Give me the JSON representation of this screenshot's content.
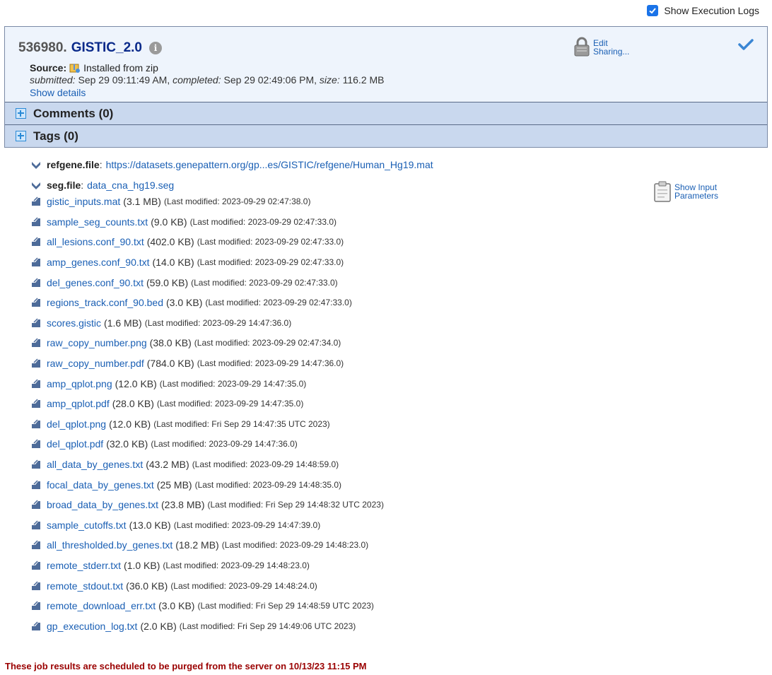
{
  "top": {
    "show_logs_label": "Show Execution Logs",
    "show_logs_checked": true
  },
  "job": {
    "id": "536980.",
    "task_name": "GISTIC_2.0",
    "source_label": "Source:",
    "source_value": "Installed from zip",
    "submitted_label": "submitted:",
    "submitted_value": " Sep 29 09:11:49 AM, ",
    "completed_label": "completed:",
    "completed_value": " Sep 29 02:49:06 PM, ",
    "size_label": "size:",
    "size_value": " 116.2 MB",
    "show_details": "Show details",
    "edit_label": "Edit",
    "sharing_label": "Sharing...",
    "show_input_label": "Show Input",
    "parameters_label": "Parameters"
  },
  "sections": {
    "comments": "Comments (0)",
    "tags": "Tags (0)"
  },
  "params": [
    {
      "name": "refgene.file",
      "value": "https://datasets.genepattern.org/gp...es/GISTIC/refgene/Human_Hg19.mat"
    },
    {
      "name": "seg.file",
      "value": "data_cna_hg19.seg"
    }
  ],
  "files": [
    {
      "name": "gistic_inputs.mat",
      "size": "(3.1 MB)",
      "modified": "(Last modified: 2023-09-29 02:47:38.0)"
    },
    {
      "name": "sample_seg_counts.txt",
      "size": "(9.0 KB)",
      "modified": "(Last modified: 2023-09-29 02:47:33.0)"
    },
    {
      "name": "all_lesions.conf_90.txt",
      "size": "(402.0 KB)",
      "modified": "(Last modified: 2023-09-29 02:47:33.0)"
    },
    {
      "name": "amp_genes.conf_90.txt",
      "size": "(14.0 KB)",
      "modified": "(Last modified: 2023-09-29 02:47:33.0)"
    },
    {
      "name": "del_genes.conf_90.txt",
      "size": "(59.0 KB)",
      "modified": "(Last modified: 2023-09-29 02:47:33.0)"
    },
    {
      "name": "regions_track.conf_90.bed",
      "size": "(3.0 KB)",
      "modified": "(Last modified: 2023-09-29 02:47:33.0)"
    },
    {
      "name": "scores.gistic",
      "size": "(1.6 MB)",
      "modified": "(Last modified: 2023-09-29 14:47:36.0)"
    },
    {
      "name": "raw_copy_number.png",
      "size": "(38.0 KB)",
      "modified": "(Last modified: 2023-09-29 02:47:34.0)"
    },
    {
      "name": "raw_copy_number.pdf",
      "size": "(784.0 KB)",
      "modified": "(Last modified: 2023-09-29 14:47:36.0)"
    },
    {
      "name": "amp_qplot.png",
      "size": "(12.0 KB)",
      "modified": "(Last modified: 2023-09-29 14:47:35.0)"
    },
    {
      "name": "amp_qplot.pdf",
      "size": "(28.0 KB)",
      "modified": "(Last modified: 2023-09-29 14:47:35.0)"
    },
    {
      "name": "del_qplot.png",
      "size": "(12.0 KB)",
      "modified": "(Last modified: Fri Sep 29 14:47:35 UTC 2023)"
    },
    {
      "name": "del_qplot.pdf",
      "size": "(32.0 KB)",
      "modified": "(Last modified: 2023-09-29 14:47:36.0)"
    },
    {
      "name": "all_data_by_genes.txt",
      "size": "(43.2 MB)",
      "modified": "(Last modified: 2023-09-29 14:48:59.0)"
    },
    {
      "name": "focal_data_by_genes.txt",
      "size": "(25 MB)",
      "modified": "(Last modified: 2023-09-29 14:48:35.0)"
    },
    {
      "name": "broad_data_by_genes.txt",
      "size": "(23.8 MB)",
      "modified": "(Last modified: Fri Sep 29 14:48:32 UTC 2023)"
    },
    {
      "name": "sample_cutoffs.txt",
      "size": "(13.0 KB)",
      "modified": "(Last modified: 2023-09-29 14:47:39.0)"
    },
    {
      "name": "all_thresholded.by_genes.txt",
      "size": "(18.2 MB)",
      "modified": "(Last modified: 2023-09-29 14:48:23.0)"
    },
    {
      "name": "remote_stderr.txt",
      "size": "(1.0 KB)",
      "modified": "(Last modified: 2023-09-29 14:48:23.0)"
    },
    {
      "name": "remote_stdout.txt",
      "size": "(36.0 KB)",
      "modified": "(Last modified: 2023-09-29 14:48:24.0)"
    },
    {
      "name": "remote_download_err.txt",
      "size": "(3.0 KB)",
      "modified": "(Last modified: Fri Sep 29 14:48:59 UTC 2023)"
    },
    {
      "name": "gp_execution_log.txt",
      "size": "(2.0 KB)",
      "modified": "(Last modified: Fri Sep 29 14:49:06 UTC 2023)"
    }
  ],
  "purge_notice": "These job results are scheduled to be purged from the server on 10/13/23 11:15 PM"
}
